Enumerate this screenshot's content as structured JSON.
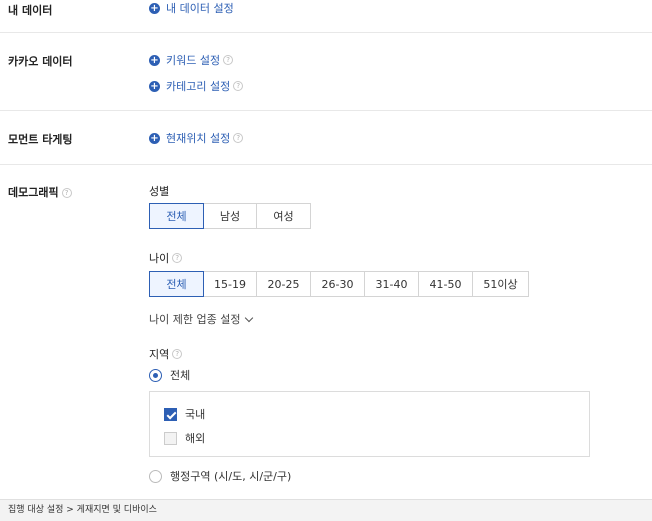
{
  "sections": {
    "my_data": {
      "label": "내 데이터",
      "link": "내 데이터 설정"
    },
    "kakao_data": {
      "label": "카카오 데이터",
      "links": [
        "키워드 설정",
        "카테고리 설정"
      ]
    },
    "moment_targeting": {
      "label": "모먼트 타게팅",
      "link": "현재위치 설정"
    },
    "demographic": {
      "label": "데모그래픽",
      "gender": {
        "title": "성별",
        "options": [
          "전체",
          "남성",
          "여성"
        ],
        "selected": "전체"
      },
      "age": {
        "title": "나이",
        "options": [
          "전체",
          "15-19",
          "20-25",
          "26-30",
          "31-40",
          "41-50",
          "51이상"
        ],
        "selected": "전체"
      },
      "age_restriction": "나이 제한 업종 설정",
      "region": {
        "title": "지역",
        "all_label": "전체",
        "domestic": "국내",
        "overseas": "해외",
        "admin_label": "행정구역 (시/도, 시/군/구)"
      }
    }
  },
  "help_glyph": "?",
  "plus_glyph": "+",
  "footer": {
    "breadcrumb": "집행 대상 설정 > 게재지면 및 디바이스"
  },
  "colors": {
    "accent": "#2d5fb4",
    "active_bg": "#eef4ff",
    "footer_bg": "#f3f3f3"
  }
}
